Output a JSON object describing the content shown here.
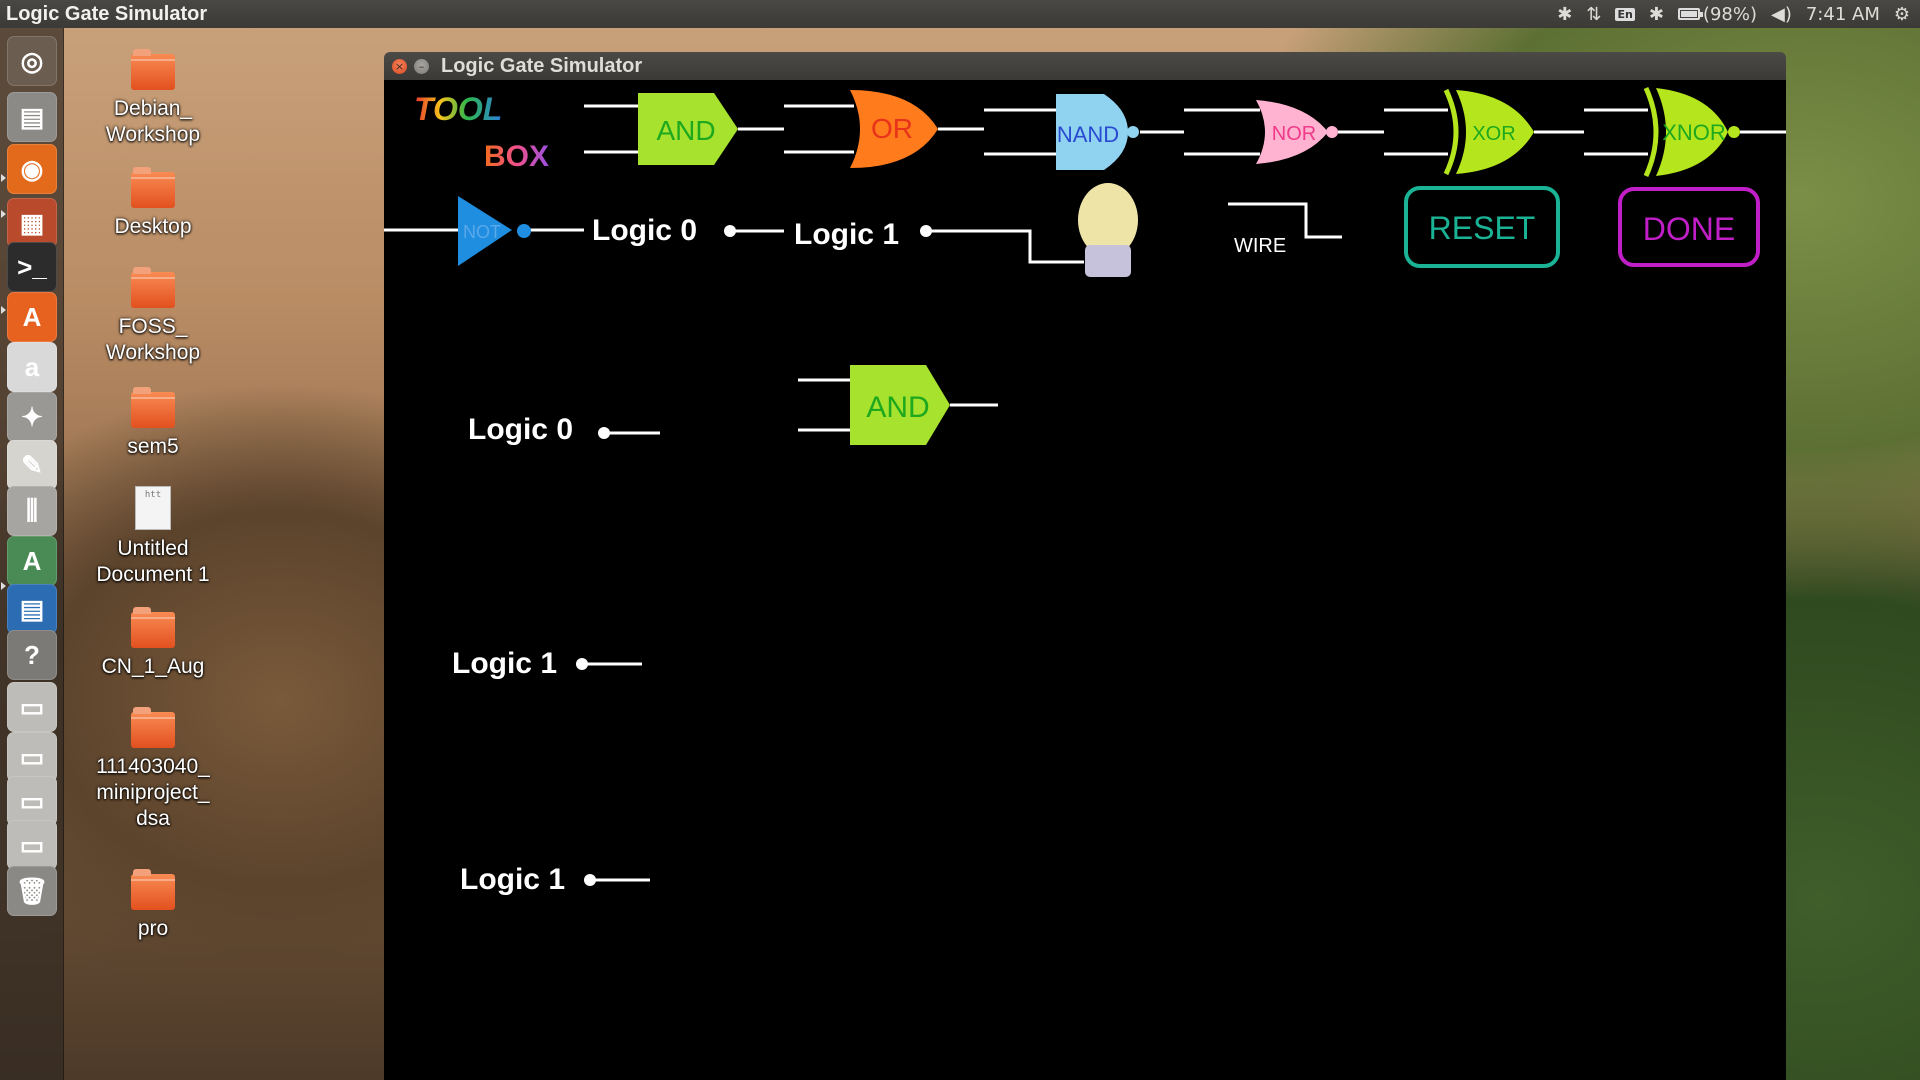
{
  "top_panel": {
    "title": "Logic Gate Simulator",
    "lang": "En",
    "battery": "(98%)",
    "battery_level": 0.98,
    "time": "7:41 AM"
  },
  "launcher": [
    {
      "name": "dash-icon",
      "glyph": "◎",
      "color": "#6b5d50"
    },
    {
      "name": "files-icon",
      "glyph": "▤",
      "color": "#8b8a86"
    },
    {
      "name": "firefox-icon",
      "glyph": "◉",
      "color": "#e46a1b"
    },
    {
      "name": "impress-icon",
      "glyph": "▦",
      "color": "#b94a2b"
    },
    {
      "name": "terminal-icon",
      "glyph": ">_",
      "color": "#2c2c2c"
    },
    {
      "name": "software-center-icon",
      "glyph": "A",
      "color": "#e8621f"
    },
    {
      "name": "amazon-icon",
      "glyph": "a",
      "color": "#d9d9d9"
    },
    {
      "name": "system-settings-icon",
      "glyph": "✦",
      "color": "#9a9894"
    },
    {
      "name": "text-editor-icon",
      "glyph": "✎",
      "color": "#d6d4cf"
    },
    {
      "name": "mixer-icon",
      "glyph": "⫼",
      "color": "#a7a5a1"
    },
    {
      "name": "software-updater-icon",
      "glyph": "A",
      "color": "#4a8a54"
    },
    {
      "name": "writer-icon",
      "glyph": "▤",
      "color": "#2b6cb3"
    },
    {
      "name": "help-icon",
      "glyph": "?",
      "color": "#7b7a76"
    },
    {
      "name": "drive-icon",
      "glyph": "▭",
      "color": "#bdbcb8"
    },
    {
      "name": "drive-icon",
      "glyph": "▭",
      "color": "#bdbcb8"
    },
    {
      "name": "drive-icon",
      "glyph": "▭",
      "color": "#bdbcb8"
    },
    {
      "name": "drive-icon",
      "glyph": "▭",
      "color": "#bdbcb8"
    },
    {
      "name": "trash-icon",
      "glyph": "🗑",
      "color": "#8a8985"
    }
  ],
  "desktop_icons": [
    {
      "label": "Debian_\nWorkshop",
      "type": "folder"
    },
    {
      "label": "Desktop",
      "type": "folder"
    },
    {
      "label": "FOSS_\nWorkshop",
      "type": "folder"
    },
    {
      "label": "sem5",
      "type": "folder"
    },
    {
      "label": "Untitled\nDocument 1",
      "type": "doc",
      "doc_text": "htt"
    },
    {
      "label": "CN_1_Aug",
      "type": "folder"
    },
    {
      "label": "111403040_\nminiproject_\ndsa",
      "type": "folder"
    },
    {
      "label": "pro",
      "type": "folder"
    }
  ],
  "window": {
    "title": "Logic Gate Simulator"
  },
  "toolbox": {
    "title_word1": "TOOL",
    "title_word2": "BOX",
    "gates": [
      {
        "label": "AND",
        "color": "#a6e22e",
        "text_color": "#1ea81e"
      },
      {
        "label": "OR",
        "color": "#ff7b1c",
        "text_color": "#e8321a"
      },
      {
        "label": "NAND",
        "color": "#8fd3f0",
        "text_color": "#2a4bd1"
      },
      {
        "label": "NOR",
        "color": "#ffb3d1",
        "text_color": "#f03a8a"
      },
      {
        "label": "XOR",
        "color": "#b5e61d",
        "text_color": "#1ea81e"
      },
      {
        "label": "XNOR",
        "color": "#b5e61d",
        "text_color": "#1ea81e"
      }
    ],
    "not_label": "NOT",
    "logic0_label": "Logic 0",
    "logic1_label": "Logic 1",
    "wire_label": "WIRE",
    "reset_label": "RESET",
    "done_label": "DONE"
  },
  "workspace": {
    "and_gate_label": "AND",
    "inputs": [
      {
        "label": "Logic 0"
      },
      {
        "label": "Logic 1"
      },
      {
        "label": "Logic 1"
      }
    ]
  }
}
